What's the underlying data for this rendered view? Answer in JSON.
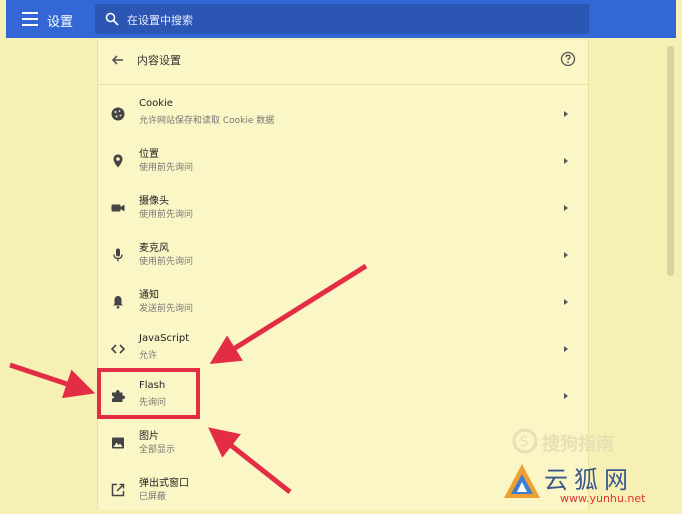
{
  "header": {
    "title": "设置",
    "search_placeholder": "在设置中搜索",
    "bg_color": "#3367d6"
  },
  "page": {
    "title": "内容设置",
    "back_icon": "arrow-back-icon",
    "help_icon": "help-circle-icon"
  },
  "settings": [
    {
      "title": "Cookie",
      "subtitle": "允许网站保存和读取 Cookie 数据",
      "icon": "cookie-icon"
    },
    {
      "title": "位置",
      "subtitle": "使用前先询问",
      "icon": "location-pin-icon"
    },
    {
      "title": "摄像头",
      "subtitle": "使用前先询问",
      "icon": "camera-icon"
    },
    {
      "title": "麦克风",
      "subtitle": "使用前先询问",
      "icon": "microphone-icon"
    },
    {
      "title": "通知",
      "subtitle": "发送前先询问",
      "icon": "bell-icon"
    },
    {
      "title": "JavaScript",
      "subtitle": "允许",
      "icon": "code-brackets-icon"
    },
    {
      "title": "Flash",
      "subtitle": "先询问",
      "icon": "puzzle-icon"
    },
    {
      "title": "图片",
      "subtitle": "全部显示",
      "icon": "image-icon"
    },
    {
      "title": "弹出式窗口",
      "subtitle": "已屏蔽",
      "icon": "open-in-new-icon"
    }
  ],
  "annotation": {
    "highlighted_item": "Flash",
    "color": "#e32d45"
  },
  "watermarks": {
    "sogou": "搜狗指南",
    "yunhu": "云狐网",
    "yunhu_url": "www.yunhu.net"
  }
}
